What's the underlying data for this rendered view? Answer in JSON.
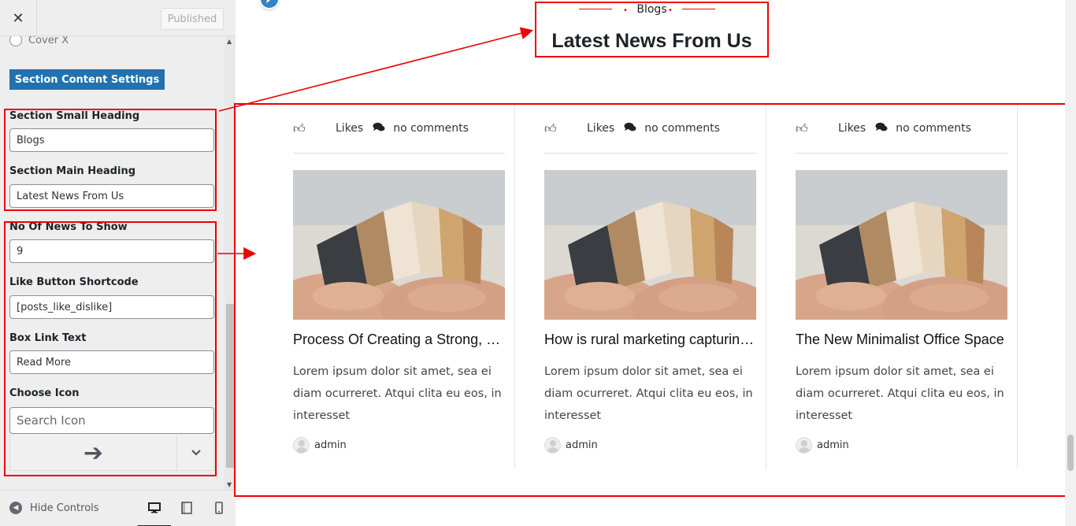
{
  "sidebar": {
    "close_symbol": "✕",
    "published_label": "Published",
    "radio_option": "Cover X",
    "section_button": "Section Content Settings",
    "fields": [
      {
        "label": "Section Small Heading",
        "value": "Blogs"
      },
      {
        "label": "Section Main Heading",
        "value": "Latest News From Us"
      },
      {
        "label": "No Of News To Show",
        "value": "9"
      },
      {
        "label": "Like Button Shortcode",
        "value": "[posts_like_dislike]"
      },
      {
        "label": "Box Link Text",
        "value": "Read More"
      },
      {
        "label": "Choose Icon",
        "placeholder": "Search Icon"
      }
    ],
    "icon_preview_symbol": "➔",
    "footer": {
      "hide_controls": "Hide Controls"
    }
  },
  "preview": {
    "small_heading": "Blogs",
    "main_heading": "Latest News From Us",
    "posts": [
      {
        "likes": "Likes",
        "comments": "no comments",
        "title": "Process Of Creating a Strong, Effective Brand",
        "excerpt": "Lorem ipsum dolor sit amet, sea ei diam ocurreret. Atqui clita eu eos, in interesset",
        "author": "admin"
      },
      {
        "likes": "Likes",
        "comments": "no comments",
        "title": "How is rural marketing capturing the market",
        "excerpt": "Lorem ipsum dolor sit amet, sea ei diam ocurreret. Atqui clita eu eos, in interesset",
        "author": "admin"
      },
      {
        "likes": "Likes",
        "comments": "no comments",
        "title": "The New Minimalist Office Space",
        "excerpt": "Lorem ipsum dolor sit amet, sea ei diam ocurreret. Atqui clita eu eos, in interesset",
        "author": "admin"
      }
    ]
  },
  "colors": {
    "accent": "#2271b1",
    "annotation": "#e00000"
  }
}
